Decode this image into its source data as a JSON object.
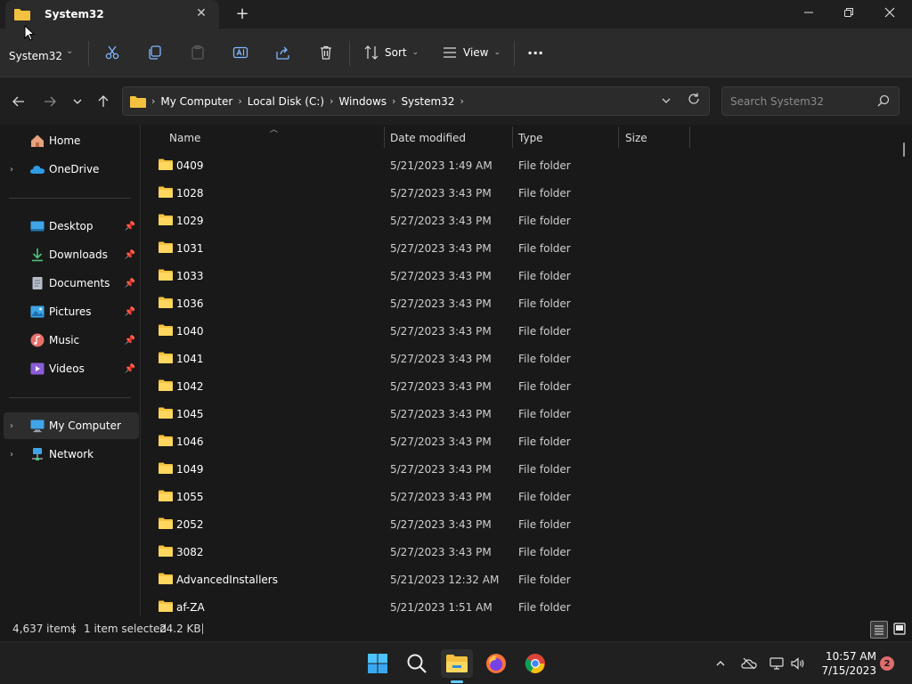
{
  "window": {
    "tab_title": "System32",
    "new_tab_glyph": "+",
    "close_glyph": "✕",
    "min_glyph": "—",
    "max_glyph": "❐"
  },
  "command_bar": {
    "location_label": "System32",
    "sort_label": "Sort",
    "view_label": "View",
    "more_glyph": "···"
  },
  "address": {
    "crumbs": [
      "My Computer",
      "Local Disk (C:)",
      "Windows",
      "System32"
    ],
    "search_placeholder": "Search System32"
  },
  "sidebar": {
    "items": [
      {
        "label": "Home",
        "icon": "home-icon"
      },
      {
        "label": "OneDrive",
        "icon": "onedrive-icon"
      },
      {
        "label": "Desktop",
        "icon": "desktop-icon"
      },
      {
        "label": "Downloads",
        "icon": "downloads-icon"
      },
      {
        "label": "Documents",
        "icon": "documents-icon"
      },
      {
        "label": "Pictures",
        "icon": "pictures-icon"
      },
      {
        "label": "Music",
        "icon": "music-icon"
      },
      {
        "label": "Videos",
        "icon": "videos-icon"
      },
      {
        "label": "My Computer",
        "icon": "computer-icon"
      },
      {
        "label": "Network",
        "icon": "network-icon"
      }
    ]
  },
  "columns": {
    "name": "Name",
    "date": "Date modified",
    "type": "Type",
    "size": "Size"
  },
  "files": [
    {
      "name": "0409",
      "date": "5/21/2023 1:49 AM",
      "type": "File folder"
    },
    {
      "name": "1028",
      "date": "5/27/2023 3:43 PM",
      "type": "File folder"
    },
    {
      "name": "1029",
      "date": "5/27/2023 3:43 PM",
      "type": "File folder"
    },
    {
      "name": "1031",
      "date": "5/27/2023 3:43 PM",
      "type": "File folder"
    },
    {
      "name": "1033",
      "date": "5/27/2023 3:43 PM",
      "type": "File folder"
    },
    {
      "name": "1036",
      "date": "5/27/2023 3:43 PM",
      "type": "File folder"
    },
    {
      "name": "1040",
      "date": "5/27/2023 3:43 PM",
      "type": "File folder"
    },
    {
      "name": "1041",
      "date": "5/27/2023 3:43 PM",
      "type": "File folder"
    },
    {
      "name": "1042",
      "date": "5/27/2023 3:43 PM",
      "type": "File folder"
    },
    {
      "name": "1045",
      "date": "5/27/2023 3:43 PM",
      "type": "File folder"
    },
    {
      "name": "1046",
      "date": "5/27/2023 3:43 PM",
      "type": "File folder"
    },
    {
      "name": "1049",
      "date": "5/27/2023 3:43 PM",
      "type": "File folder"
    },
    {
      "name": "1055",
      "date": "5/27/2023 3:43 PM",
      "type": "File folder"
    },
    {
      "name": "2052",
      "date": "5/27/2023 3:43 PM",
      "type": "File folder"
    },
    {
      "name": "3082",
      "date": "5/27/2023 3:43 PM",
      "type": "File folder"
    },
    {
      "name": "AdvancedInstallers",
      "date": "5/21/2023 12:32 AM",
      "type": "File folder"
    },
    {
      "name": "af-ZA",
      "date": "5/21/2023 1:51 AM",
      "type": "File folder"
    }
  ],
  "status": {
    "item_count": "4,637 items",
    "selected": "1 item selected",
    "selected_size": "24.2 KB"
  },
  "taskbar": {
    "time": "10:57 AM",
    "date": "7/15/2023",
    "notification_count": "2"
  },
  "colors": {
    "folder": "#f3c13f",
    "accent": "#60cdff",
    "background": "#191919"
  }
}
